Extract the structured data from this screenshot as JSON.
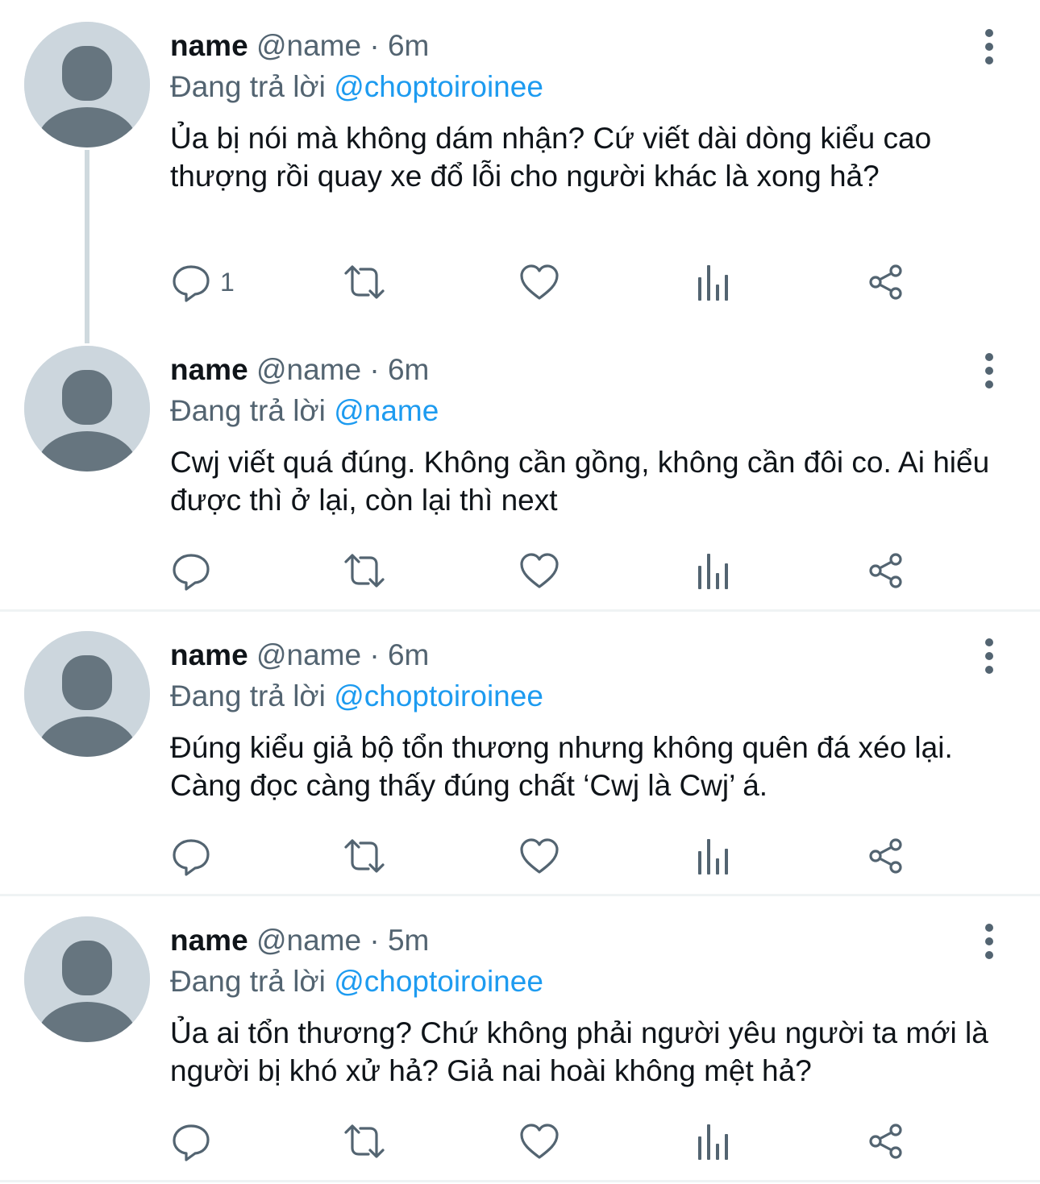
{
  "tweets": [
    {
      "display_name": "name",
      "handle": "@name",
      "separator": "·",
      "time": "6m",
      "replying_prefix": "Đang trả lời",
      "replying_to": "@choptoiroinee",
      "text": "Ủa bị nói mà không dám nhận? Cứ viết dài dòng kiểu cao thượng rồi quay xe đổ lỗi cho người khác là xong hả?",
      "reply_count": "1"
    },
    {
      "display_name": "name",
      "handle": "@name",
      "separator": "·",
      "time": "6m",
      "replying_prefix": "Đang trả lời",
      "replying_to": "@name",
      "text": "Cwj viết quá đúng. Không cần gồng, không cần đôi co. Ai hiểu được thì ở lại, còn lại thì next",
      "reply_count": ""
    },
    {
      "display_name": "name",
      "handle": "@name",
      "separator": "·",
      "time": "6m",
      "replying_prefix": "Đang trả lời",
      "replying_to": "@choptoiroinee",
      "text": "Đúng kiểu giả bộ tổn thương nhưng không quên đá xéo lại. Càng đọc càng thấy đúng chất ‘Cwj là Cwj’ á.",
      "reply_count": ""
    },
    {
      "display_name": "name",
      "handle": "@name",
      "separator": "·",
      "time": "5m",
      "replying_prefix": "Đang trả lời",
      "replying_to": "@choptoiroinee",
      "text": "Ủa ai tổn thương? Chứ không phải người yêu người ta mới là người bị khó xử hả? Giả nai hoài không mệt hả?",
      "reply_count": ""
    }
  ],
  "icons": {
    "reply": "reply-icon",
    "retweet": "retweet-icon",
    "like": "like-icon",
    "views": "views-icon",
    "share": "share-icon",
    "more": "more-options-icon",
    "avatar": "default-avatar-icon"
  },
  "colors": {
    "text": "#0f1419",
    "secondary": "#536471",
    "mention": "#1d9bf0",
    "avatar_bg": "#ccd6dd",
    "avatar_fg": "#66757f",
    "divider": "#eff3f4",
    "thread_line": "#cfd9de"
  }
}
